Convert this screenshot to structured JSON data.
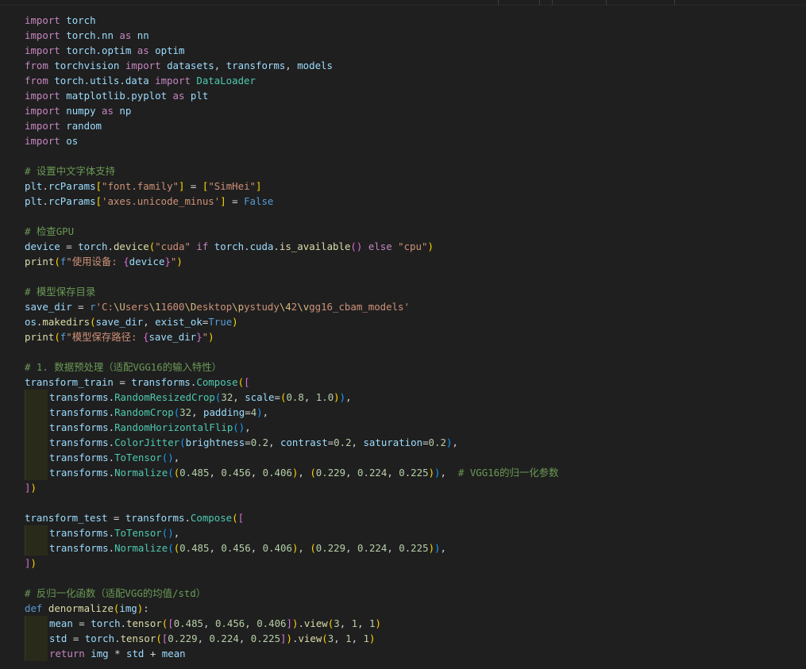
{
  "editor": {
    "language": "python",
    "lines": [
      [
        [
          "kw",
          "import"
        ],
        [
          "plain",
          " "
        ],
        [
          "ident",
          "torch"
        ]
      ],
      [
        [
          "kw",
          "import"
        ],
        [
          "plain",
          " "
        ],
        [
          "ident",
          "torch.nn"
        ],
        [
          "plain",
          " "
        ],
        [
          "kw",
          "as"
        ],
        [
          "plain",
          " "
        ],
        [
          "ident",
          "nn"
        ]
      ],
      [
        [
          "kw",
          "import"
        ],
        [
          "plain",
          " "
        ],
        [
          "ident",
          "torch.optim"
        ],
        [
          "plain",
          " "
        ],
        [
          "kw",
          "as"
        ],
        [
          "plain",
          " "
        ],
        [
          "ident",
          "optim"
        ]
      ],
      [
        [
          "kw",
          "from"
        ],
        [
          "plain",
          " "
        ],
        [
          "ident",
          "torchvision"
        ],
        [
          "plain",
          " "
        ],
        [
          "kw",
          "import"
        ],
        [
          "plain",
          " "
        ],
        [
          "ident",
          "datasets"
        ],
        [
          "plain",
          ", "
        ],
        [
          "ident",
          "transforms"
        ],
        [
          "plain",
          ", "
        ],
        [
          "ident",
          "models"
        ]
      ],
      [
        [
          "kw",
          "from"
        ],
        [
          "plain",
          " "
        ],
        [
          "ident",
          "torch.utils.data"
        ],
        [
          "plain",
          " "
        ],
        [
          "kw",
          "import"
        ],
        [
          "plain",
          " "
        ],
        [
          "mod",
          "DataLoader"
        ]
      ],
      [
        [
          "kw",
          "import"
        ],
        [
          "plain",
          " "
        ],
        [
          "ident",
          "matplotlib.pyplot"
        ],
        [
          "plain",
          " "
        ],
        [
          "kw",
          "as"
        ],
        [
          "plain",
          " "
        ],
        [
          "ident",
          "plt"
        ]
      ],
      [
        [
          "kw",
          "import"
        ],
        [
          "plain",
          " "
        ],
        [
          "ident",
          "numpy"
        ],
        [
          "plain",
          " "
        ],
        [
          "kw",
          "as"
        ],
        [
          "plain",
          " "
        ],
        [
          "ident",
          "np"
        ]
      ],
      [
        [
          "kw",
          "import"
        ],
        [
          "plain",
          " "
        ],
        [
          "ident",
          "random"
        ]
      ],
      [
        [
          "kw",
          "import"
        ],
        [
          "plain",
          " "
        ],
        [
          "ident",
          "os"
        ]
      ],
      [],
      [
        [
          "cmt",
          "# 设置中文字体支持"
        ]
      ],
      [
        [
          "ident",
          "plt"
        ],
        [
          "plain",
          "."
        ],
        [
          "ident",
          "rcParams"
        ],
        [
          "b1",
          "["
        ],
        [
          "str",
          "\"font.family\""
        ],
        [
          "b1",
          "]"
        ],
        [
          "plain",
          " = "
        ],
        [
          "b1",
          "["
        ],
        [
          "str",
          "\"SimHei\""
        ],
        [
          "b1",
          "]"
        ]
      ],
      [
        [
          "ident",
          "plt"
        ],
        [
          "plain",
          "."
        ],
        [
          "ident",
          "rcParams"
        ],
        [
          "b1",
          "["
        ],
        [
          "str",
          "'axes.unicode_minus'"
        ],
        [
          "b1",
          "]"
        ],
        [
          "plain",
          " = "
        ],
        [
          "kb",
          "False"
        ]
      ],
      [],
      [
        [
          "cmt",
          "# 检查GPU"
        ]
      ],
      [
        [
          "ident",
          "device"
        ],
        [
          "plain",
          " = "
        ],
        [
          "ident",
          "torch"
        ],
        [
          "plain",
          "."
        ],
        [
          "fn",
          "device"
        ],
        [
          "b1",
          "("
        ],
        [
          "str",
          "\"cuda\""
        ],
        [
          "plain",
          " "
        ],
        [
          "kw",
          "if"
        ],
        [
          "plain",
          " "
        ],
        [
          "ident",
          "torch"
        ],
        [
          "plain",
          "."
        ],
        [
          "ident",
          "cuda"
        ],
        [
          "plain",
          "."
        ],
        [
          "fn",
          "is_available"
        ],
        [
          "b2",
          "()"
        ],
        [
          "plain",
          " "
        ],
        [
          "kw",
          "else"
        ],
        [
          "plain",
          " "
        ],
        [
          "str",
          "\"cpu\""
        ],
        [
          "b1",
          ")"
        ]
      ],
      [
        [
          "fn",
          "print"
        ],
        [
          "b1",
          "("
        ],
        [
          "kb",
          "f"
        ],
        [
          "str",
          "\"使用设备: "
        ],
        [
          "b2",
          "{"
        ],
        [
          "ident",
          "device"
        ],
        [
          "b2",
          "}"
        ],
        [
          "str",
          "\""
        ],
        [
          "b1",
          ")"
        ]
      ],
      [],
      [
        [
          "cmt",
          "# 模型保存目录"
        ]
      ],
      [
        [
          "ident",
          "save_dir"
        ],
        [
          "plain",
          " = "
        ],
        [
          "kb",
          "r"
        ],
        [
          "str",
          "'C:"
        ],
        [
          "esc",
          "\\U"
        ],
        [
          "str",
          "sers"
        ],
        [
          "esc",
          "\\1"
        ],
        [
          "str",
          "1600"
        ],
        [
          "esc",
          "\\D"
        ],
        [
          "str",
          "esktop"
        ],
        [
          "esc",
          "\\p"
        ],
        [
          "str",
          "ystudy"
        ],
        [
          "esc",
          "\\4"
        ],
        [
          "str",
          "2"
        ],
        [
          "esc",
          "\\v"
        ],
        [
          "str",
          "gg16_cbam_models'"
        ]
      ],
      [
        [
          "ident",
          "os"
        ],
        [
          "plain",
          "."
        ],
        [
          "fn",
          "makedirs"
        ],
        [
          "b1",
          "("
        ],
        [
          "ident",
          "save_dir"
        ],
        [
          "plain",
          ", "
        ],
        [
          "ident",
          "exist_ok"
        ],
        [
          "plain",
          "="
        ],
        [
          "kb",
          "True"
        ],
        [
          "b1",
          ")"
        ]
      ],
      [
        [
          "fn",
          "print"
        ],
        [
          "b1",
          "("
        ],
        [
          "kb",
          "f"
        ],
        [
          "str",
          "\"模型保存路径: "
        ],
        [
          "b2",
          "{"
        ],
        [
          "ident",
          "save_dir"
        ],
        [
          "b2",
          "}"
        ],
        [
          "str",
          "\""
        ],
        [
          "b1",
          ")"
        ]
      ],
      [],
      [
        [
          "cmt",
          "# 1. 数据预处理（适配VGG16的输入特性）"
        ]
      ],
      [
        [
          "ident",
          "transform_train"
        ],
        [
          "plain",
          " = "
        ],
        [
          "ident",
          "transforms"
        ],
        [
          "plain",
          "."
        ],
        [
          "mod",
          "Compose"
        ],
        [
          "b1",
          "("
        ],
        [
          "b2",
          "["
        ]
      ],
      [
        [
          "indent"
        ],
        [
          "ident",
          "transforms"
        ],
        [
          "plain",
          "."
        ],
        [
          "mod",
          "RandomResizedCrop"
        ],
        [
          "b3",
          "("
        ],
        [
          "num",
          "32"
        ],
        [
          "plain",
          ", "
        ],
        [
          "ident",
          "scale"
        ],
        [
          "plain",
          "="
        ],
        [
          "b1",
          "("
        ],
        [
          "num",
          "0.8"
        ],
        [
          "plain",
          ", "
        ],
        [
          "num",
          "1.0"
        ],
        [
          "b1",
          ")"
        ],
        [
          "b3",
          ")"
        ],
        [
          "plain",
          ","
        ]
      ],
      [
        [
          "indent"
        ],
        [
          "ident",
          "transforms"
        ],
        [
          "plain",
          "."
        ],
        [
          "mod",
          "RandomCrop"
        ],
        [
          "b3",
          "("
        ],
        [
          "num",
          "32"
        ],
        [
          "plain",
          ", "
        ],
        [
          "ident",
          "padding"
        ],
        [
          "plain",
          "="
        ],
        [
          "num",
          "4"
        ],
        [
          "b3",
          ")"
        ],
        [
          "plain",
          ","
        ]
      ],
      [
        [
          "indent"
        ],
        [
          "ident",
          "transforms"
        ],
        [
          "plain",
          "."
        ],
        [
          "mod",
          "RandomHorizontalFlip"
        ],
        [
          "b3",
          "()"
        ],
        [
          "plain",
          ","
        ]
      ],
      [
        [
          "indent"
        ],
        [
          "ident",
          "transforms"
        ],
        [
          "plain",
          "."
        ],
        [
          "mod",
          "ColorJitter"
        ],
        [
          "b3",
          "("
        ],
        [
          "ident",
          "brightness"
        ],
        [
          "plain",
          "="
        ],
        [
          "num",
          "0.2"
        ],
        [
          "plain",
          ", "
        ],
        [
          "ident",
          "contrast"
        ],
        [
          "plain",
          "="
        ],
        [
          "num",
          "0.2"
        ],
        [
          "plain",
          ", "
        ],
        [
          "ident",
          "saturation"
        ],
        [
          "plain",
          "="
        ],
        [
          "num",
          "0.2"
        ],
        [
          "b3",
          ")"
        ],
        [
          "plain",
          ","
        ]
      ],
      [
        [
          "indent"
        ],
        [
          "ident",
          "transforms"
        ],
        [
          "plain",
          "."
        ],
        [
          "mod",
          "ToTensor"
        ],
        [
          "b3",
          "()"
        ],
        [
          "plain",
          ","
        ]
      ],
      [
        [
          "indent"
        ],
        [
          "ident",
          "transforms"
        ],
        [
          "plain",
          "."
        ],
        [
          "mod",
          "Normalize"
        ],
        [
          "b3",
          "("
        ],
        [
          "b1",
          "("
        ],
        [
          "num",
          "0.485"
        ],
        [
          "plain",
          ", "
        ],
        [
          "num",
          "0.456"
        ],
        [
          "plain",
          ", "
        ],
        [
          "num",
          "0.406"
        ],
        [
          "b1",
          ")"
        ],
        [
          "plain",
          ", "
        ],
        [
          "b1",
          "("
        ],
        [
          "num",
          "0.229"
        ],
        [
          "plain",
          ", "
        ],
        [
          "num",
          "0.224"
        ],
        [
          "plain",
          ", "
        ],
        [
          "num",
          "0.225"
        ],
        [
          "b1",
          ")"
        ],
        [
          "b3",
          ")"
        ],
        [
          "plain",
          ",  "
        ],
        [
          "cmt",
          "# VGG16的归一化参数"
        ]
      ],
      [
        [
          "b2",
          "]"
        ],
        [
          "b1",
          ")"
        ]
      ],
      [],
      [
        [
          "ident",
          "transform_test"
        ],
        [
          "plain",
          " = "
        ],
        [
          "ident",
          "transforms"
        ],
        [
          "plain",
          "."
        ],
        [
          "mod",
          "Compose"
        ],
        [
          "b1",
          "("
        ],
        [
          "b2",
          "["
        ]
      ],
      [
        [
          "indent"
        ],
        [
          "ident",
          "transforms"
        ],
        [
          "plain",
          "."
        ],
        [
          "mod",
          "ToTensor"
        ],
        [
          "b3",
          "()"
        ],
        [
          "plain",
          ","
        ]
      ],
      [
        [
          "indent"
        ],
        [
          "ident",
          "transforms"
        ],
        [
          "plain",
          "."
        ],
        [
          "mod",
          "Normalize"
        ],
        [
          "b3",
          "("
        ],
        [
          "b1",
          "("
        ],
        [
          "num",
          "0.485"
        ],
        [
          "plain",
          ", "
        ],
        [
          "num",
          "0.456"
        ],
        [
          "plain",
          ", "
        ],
        [
          "num",
          "0.406"
        ],
        [
          "b1",
          ")"
        ],
        [
          "plain",
          ", "
        ],
        [
          "b1",
          "("
        ],
        [
          "num",
          "0.229"
        ],
        [
          "plain",
          ", "
        ],
        [
          "num",
          "0.224"
        ],
        [
          "plain",
          ", "
        ],
        [
          "num",
          "0.225"
        ],
        [
          "b1",
          ")"
        ],
        [
          "b3",
          ")"
        ],
        [
          "plain",
          ","
        ]
      ],
      [
        [
          "b2",
          "]"
        ],
        [
          "b1",
          ")"
        ]
      ],
      [],
      [
        [
          "cmt",
          "# 反归一化函数（适配VGG的均值/std）"
        ]
      ],
      [
        [
          "kb",
          "def"
        ],
        [
          "plain",
          " "
        ],
        [
          "fn",
          "denormalize"
        ],
        [
          "b1",
          "("
        ],
        [
          "ident",
          "img"
        ],
        [
          "b1",
          ")"
        ],
        [
          "plain",
          ":"
        ]
      ],
      [
        [
          "indent"
        ],
        [
          "ident",
          "mean"
        ],
        [
          "plain",
          " = "
        ],
        [
          "ident",
          "torch"
        ],
        [
          "plain",
          "."
        ],
        [
          "fn",
          "tensor"
        ],
        [
          "b1",
          "("
        ],
        [
          "b2",
          "["
        ],
        [
          "num",
          "0.485"
        ],
        [
          "plain",
          ", "
        ],
        [
          "num",
          "0.456"
        ],
        [
          "plain",
          ", "
        ],
        [
          "num",
          "0.406"
        ],
        [
          "b2",
          "]"
        ],
        [
          "b1",
          ")"
        ],
        [
          "plain",
          "."
        ],
        [
          "fn",
          "view"
        ],
        [
          "b1",
          "("
        ],
        [
          "num",
          "3"
        ],
        [
          "plain",
          ", "
        ],
        [
          "num",
          "1"
        ],
        [
          "plain",
          ", "
        ],
        [
          "num",
          "1"
        ],
        [
          "b1",
          ")"
        ]
      ],
      [
        [
          "indent"
        ],
        [
          "ident",
          "std"
        ],
        [
          "plain",
          " = "
        ],
        [
          "ident",
          "torch"
        ],
        [
          "plain",
          "."
        ],
        [
          "fn",
          "tensor"
        ],
        [
          "b1",
          "("
        ],
        [
          "b2",
          "["
        ],
        [
          "num",
          "0.229"
        ],
        [
          "plain",
          ", "
        ],
        [
          "num",
          "0.224"
        ],
        [
          "plain",
          ", "
        ],
        [
          "num",
          "0.225"
        ],
        [
          "b2",
          "]"
        ],
        [
          "b1",
          ")"
        ],
        [
          "plain",
          "."
        ],
        [
          "fn",
          "view"
        ],
        [
          "b1",
          "("
        ],
        [
          "num",
          "3"
        ],
        [
          "plain",
          ", "
        ],
        [
          "num",
          "1"
        ],
        [
          "plain",
          ", "
        ],
        [
          "num",
          "1"
        ],
        [
          "b1",
          ")"
        ]
      ],
      [
        [
          "indent"
        ],
        [
          "kw",
          "return"
        ],
        [
          "plain",
          " "
        ],
        [
          "ident",
          "img"
        ],
        [
          "plain",
          " * "
        ],
        [
          "ident",
          "std"
        ],
        [
          "plain",
          " + "
        ],
        [
          "ident",
          "mean"
        ]
      ]
    ]
  }
}
